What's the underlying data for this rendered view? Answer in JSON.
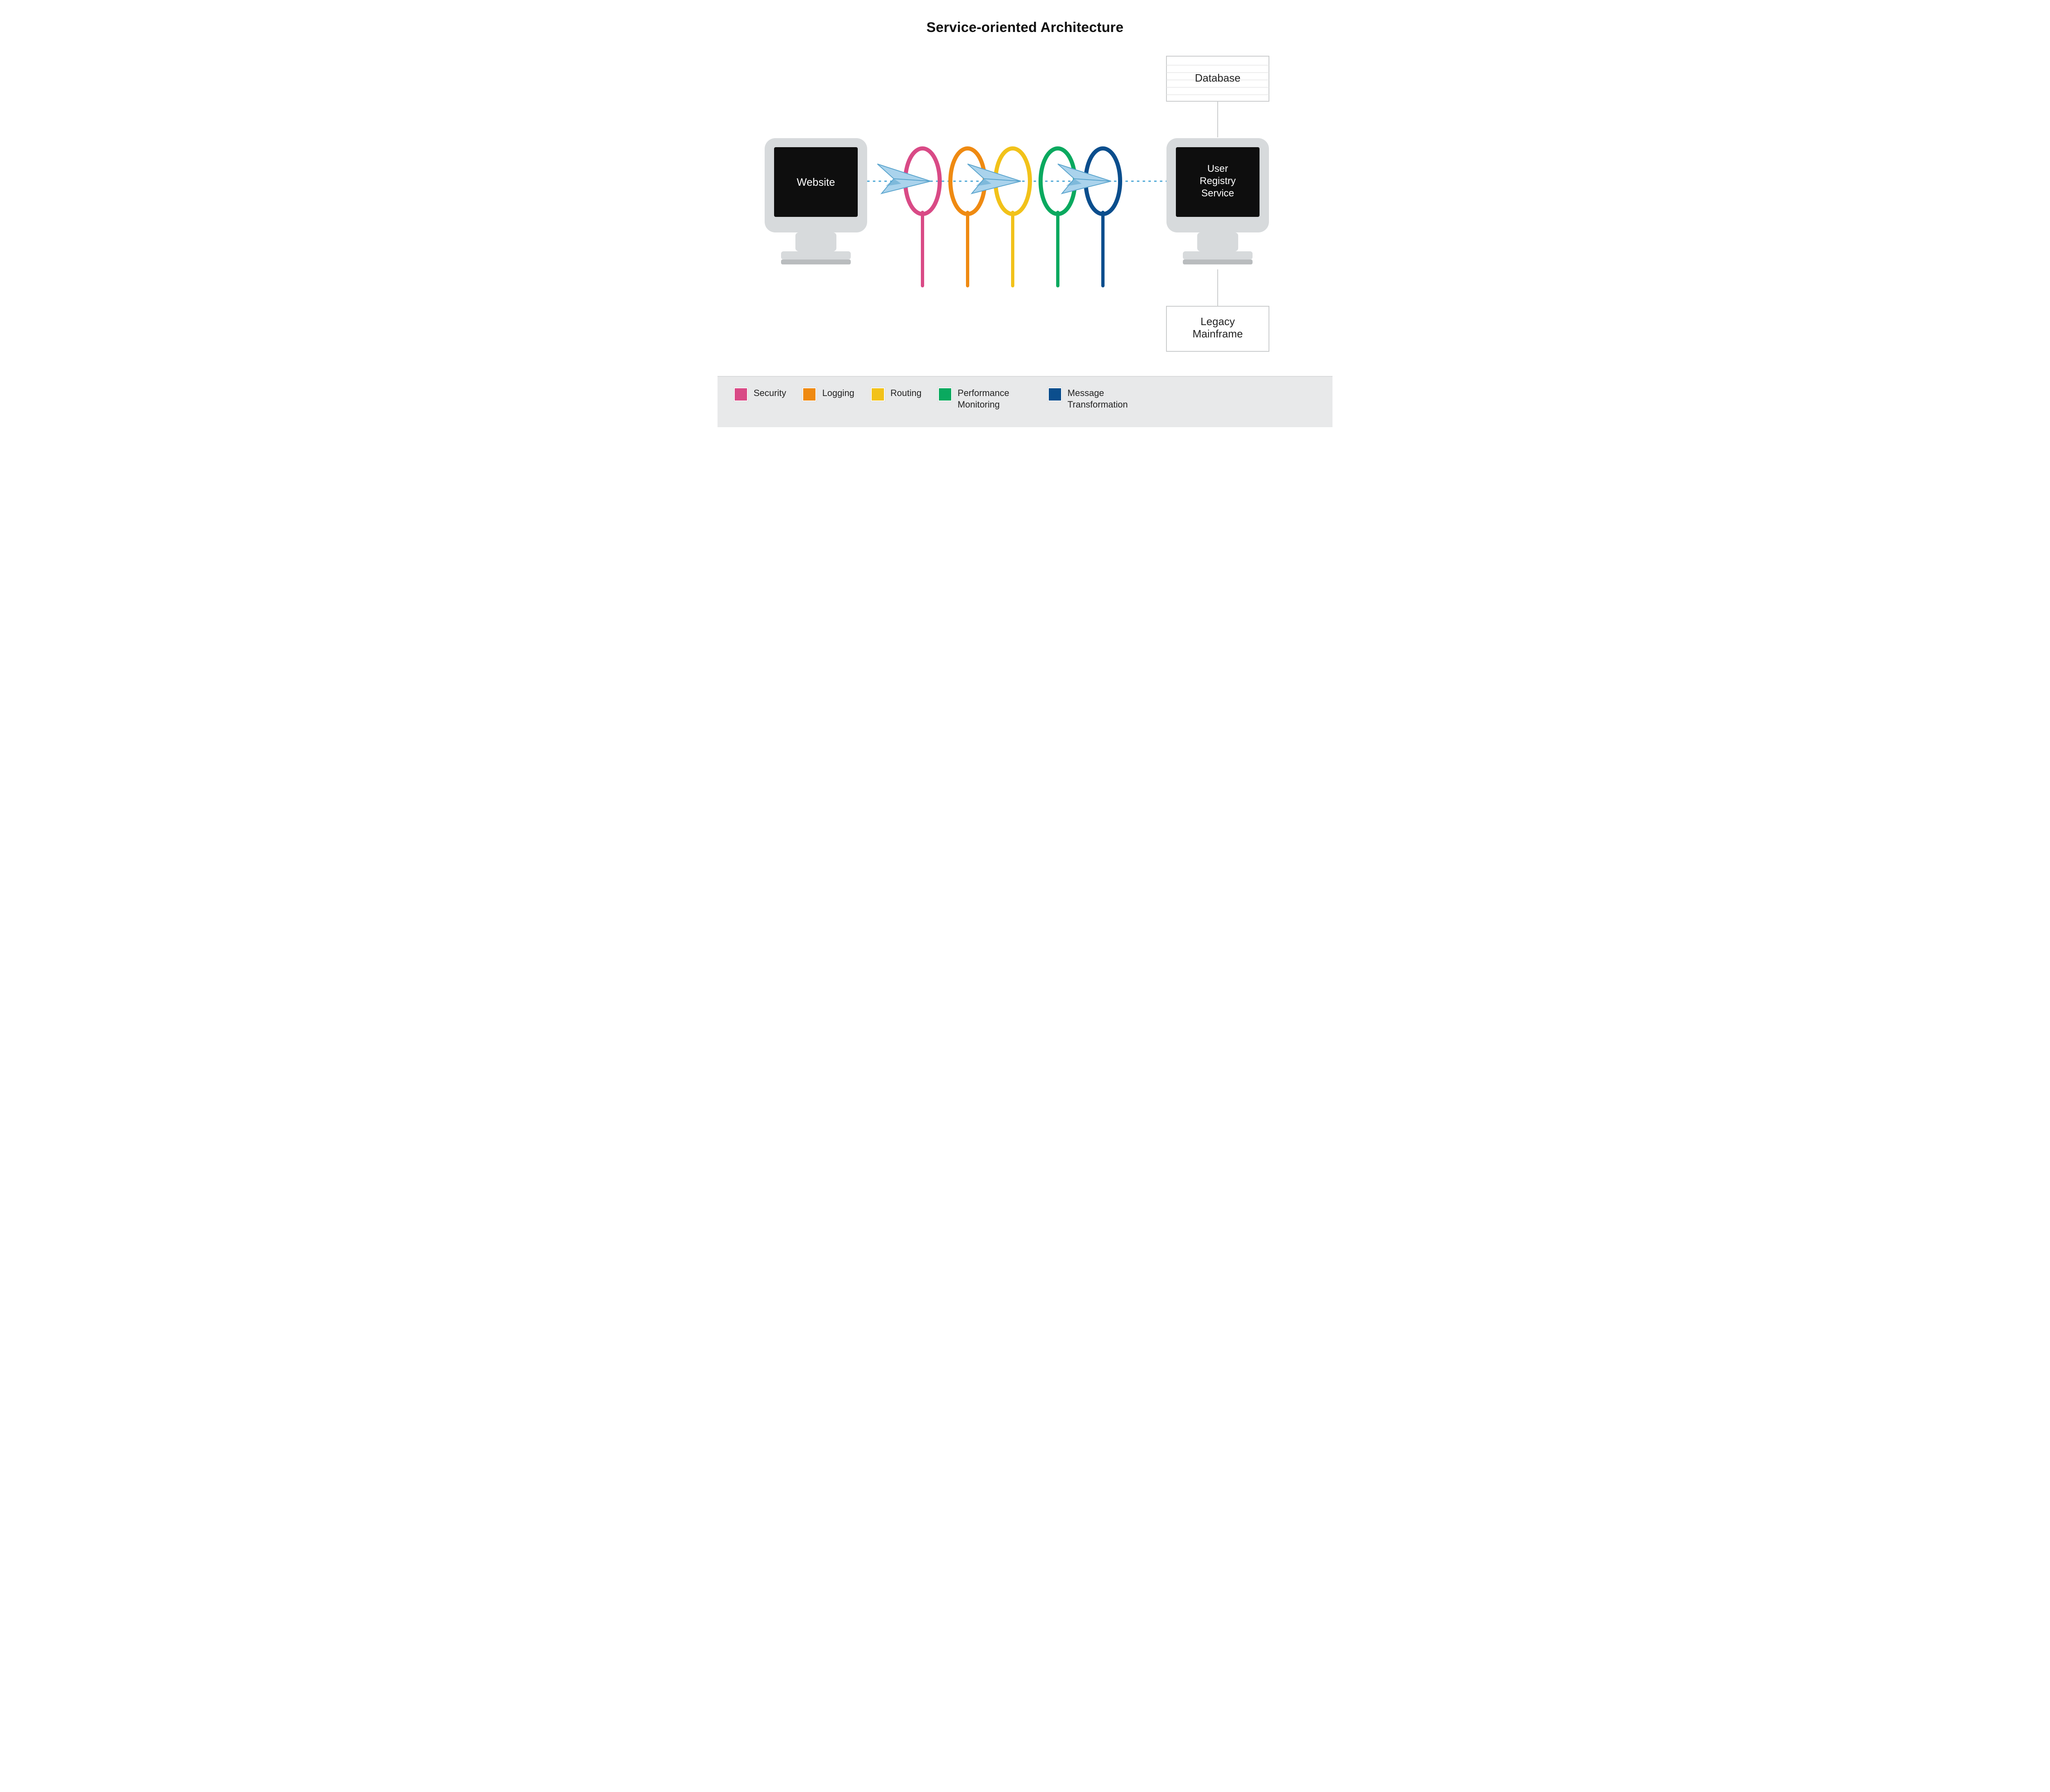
{
  "title": "Service-oriented Architecture",
  "nodes": {
    "left_computer_label": "Website",
    "right_computer_label_line1": "User",
    "right_computer_label_line2": "Registry",
    "right_computer_label_line3": "Service",
    "database_label": "Database",
    "legacy_label_line1": "Legacy",
    "legacy_label_line2": "Mainframe"
  },
  "rings": [
    {
      "id": "security",
      "color": "#d94a86"
    },
    {
      "id": "logging",
      "color": "#ef8a12"
    },
    {
      "id": "routing",
      "color": "#f2c21a"
    },
    {
      "id": "performance",
      "color": "#0aa95f"
    },
    {
      "id": "message",
      "color": "#0b4e8d"
    }
  ],
  "legend": [
    {
      "color": "#d94a86",
      "label": "Security"
    },
    {
      "color": "#ef8a12",
      "label": "Logging"
    },
    {
      "color": "#f2c21a",
      "label": "Routing"
    },
    {
      "color": "#0aa95f",
      "label": "Performance Monitoring"
    },
    {
      "color": "#0b4e8d",
      "label": "Message Transformation"
    }
  ],
  "colors": {
    "computer_body": "#d7dadc",
    "computer_body_dark": "#b9bcbe",
    "screen": "#0e0e0e",
    "screen_text": "#ffffff",
    "box_border": "#c9cbcc",
    "dashed": "#4aa6d6",
    "plane_fill": "#aad3ec",
    "plane_stroke": "#5aa4cd",
    "legend_bg": "#e8e9ea"
  }
}
